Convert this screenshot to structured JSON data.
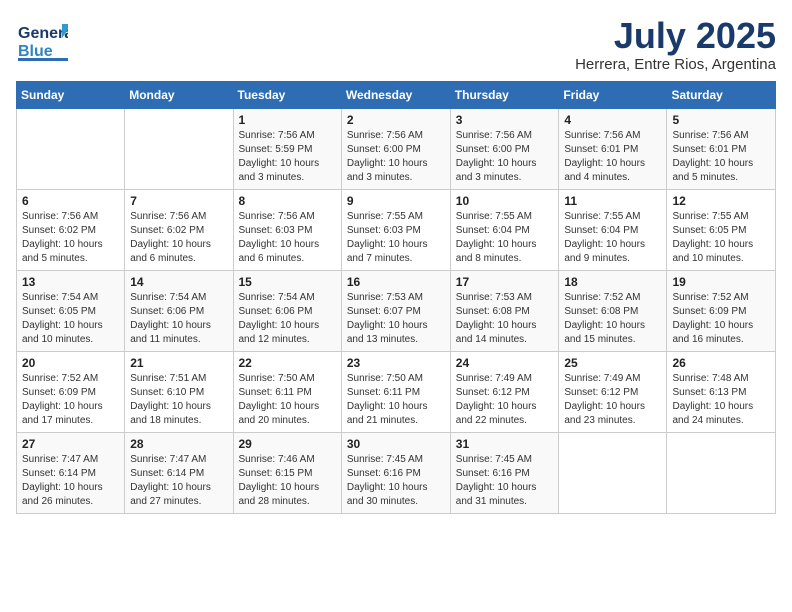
{
  "header": {
    "logo_general": "General",
    "logo_blue": "Blue",
    "month_title": "July 2025",
    "location": "Herrera, Entre Rios, Argentina"
  },
  "weekdays": [
    "Sunday",
    "Monday",
    "Tuesday",
    "Wednesday",
    "Thursday",
    "Friday",
    "Saturday"
  ],
  "weeks": [
    [
      {
        "day": "",
        "sunrise": "",
        "sunset": "",
        "daylight": ""
      },
      {
        "day": "",
        "sunrise": "",
        "sunset": "",
        "daylight": ""
      },
      {
        "day": "1",
        "sunrise": "Sunrise: 7:56 AM",
        "sunset": "Sunset: 5:59 PM",
        "daylight": "Daylight: 10 hours and 3 minutes."
      },
      {
        "day": "2",
        "sunrise": "Sunrise: 7:56 AM",
        "sunset": "Sunset: 6:00 PM",
        "daylight": "Daylight: 10 hours and 3 minutes."
      },
      {
        "day": "3",
        "sunrise": "Sunrise: 7:56 AM",
        "sunset": "Sunset: 6:00 PM",
        "daylight": "Daylight: 10 hours and 3 minutes."
      },
      {
        "day": "4",
        "sunrise": "Sunrise: 7:56 AM",
        "sunset": "Sunset: 6:01 PM",
        "daylight": "Daylight: 10 hours and 4 minutes."
      },
      {
        "day": "5",
        "sunrise": "Sunrise: 7:56 AM",
        "sunset": "Sunset: 6:01 PM",
        "daylight": "Daylight: 10 hours and 5 minutes."
      }
    ],
    [
      {
        "day": "6",
        "sunrise": "Sunrise: 7:56 AM",
        "sunset": "Sunset: 6:02 PM",
        "daylight": "Daylight: 10 hours and 5 minutes."
      },
      {
        "day": "7",
        "sunrise": "Sunrise: 7:56 AM",
        "sunset": "Sunset: 6:02 PM",
        "daylight": "Daylight: 10 hours and 6 minutes."
      },
      {
        "day": "8",
        "sunrise": "Sunrise: 7:56 AM",
        "sunset": "Sunset: 6:03 PM",
        "daylight": "Daylight: 10 hours and 6 minutes."
      },
      {
        "day": "9",
        "sunrise": "Sunrise: 7:55 AM",
        "sunset": "Sunset: 6:03 PM",
        "daylight": "Daylight: 10 hours and 7 minutes."
      },
      {
        "day": "10",
        "sunrise": "Sunrise: 7:55 AM",
        "sunset": "Sunset: 6:04 PM",
        "daylight": "Daylight: 10 hours and 8 minutes."
      },
      {
        "day": "11",
        "sunrise": "Sunrise: 7:55 AM",
        "sunset": "Sunset: 6:04 PM",
        "daylight": "Daylight: 10 hours and 9 minutes."
      },
      {
        "day": "12",
        "sunrise": "Sunrise: 7:55 AM",
        "sunset": "Sunset: 6:05 PM",
        "daylight": "Daylight: 10 hours and 10 minutes."
      }
    ],
    [
      {
        "day": "13",
        "sunrise": "Sunrise: 7:54 AM",
        "sunset": "Sunset: 6:05 PM",
        "daylight": "Daylight: 10 hours and 10 minutes."
      },
      {
        "day": "14",
        "sunrise": "Sunrise: 7:54 AM",
        "sunset": "Sunset: 6:06 PM",
        "daylight": "Daylight: 10 hours and 11 minutes."
      },
      {
        "day": "15",
        "sunrise": "Sunrise: 7:54 AM",
        "sunset": "Sunset: 6:06 PM",
        "daylight": "Daylight: 10 hours and 12 minutes."
      },
      {
        "day": "16",
        "sunrise": "Sunrise: 7:53 AM",
        "sunset": "Sunset: 6:07 PM",
        "daylight": "Daylight: 10 hours and 13 minutes."
      },
      {
        "day": "17",
        "sunrise": "Sunrise: 7:53 AM",
        "sunset": "Sunset: 6:08 PM",
        "daylight": "Daylight: 10 hours and 14 minutes."
      },
      {
        "day": "18",
        "sunrise": "Sunrise: 7:52 AM",
        "sunset": "Sunset: 6:08 PM",
        "daylight": "Daylight: 10 hours and 15 minutes."
      },
      {
        "day": "19",
        "sunrise": "Sunrise: 7:52 AM",
        "sunset": "Sunset: 6:09 PM",
        "daylight": "Daylight: 10 hours and 16 minutes."
      }
    ],
    [
      {
        "day": "20",
        "sunrise": "Sunrise: 7:52 AM",
        "sunset": "Sunset: 6:09 PM",
        "daylight": "Daylight: 10 hours and 17 minutes."
      },
      {
        "day": "21",
        "sunrise": "Sunrise: 7:51 AM",
        "sunset": "Sunset: 6:10 PM",
        "daylight": "Daylight: 10 hours and 18 minutes."
      },
      {
        "day": "22",
        "sunrise": "Sunrise: 7:50 AM",
        "sunset": "Sunset: 6:11 PM",
        "daylight": "Daylight: 10 hours and 20 minutes."
      },
      {
        "day": "23",
        "sunrise": "Sunrise: 7:50 AM",
        "sunset": "Sunset: 6:11 PM",
        "daylight": "Daylight: 10 hours and 21 minutes."
      },
      {
        "day": "24",
        "sunrise": "Sunrise: 7:49 AM",
        "sunset": "Sunset: 6:12 PM",
        "daylight": "Daylight: 10 hours and 22 minutes."
      },
      {
        "day": "25",
        "sunrise": "Sunrise: 7:49 AM",
        "sunset": "Sunset: 6:12 PM",
        "daylight": "Daylight: 10 hours and 23 minutes."
      },
      {
        "day": "26",
        "sunrise": "Sunrise: 7:48 AM",
        "sunset": "Sunset: 6:13 PM",
        "daylight": "Daylight: 10 hours and 24 minutes."
      }
    ],
    [
      {
        "day": "27",
        "sunrise": "Sunrise: 7:47 AM",
        "sunset": "Sunset: 6:14 PM",
        "daylight": "Daylight: 10 hours and 26 minutes."
      },
      {
        "day": "28",
        "sunrise": "Sunrise: 7:47 AM",
        "sunset": "Sunset: 6:14 PM",
        "daylight": "Daylight: 10 hours and 27 minutes."
      },
      {
        "day": "29",
        "sunrise": "Sunrise: 7:46 AM",
        "sunset": "Sunset: 6:15 PM",
        "daylight": "Daylight: 10 hours and 28 minutes."
      },
      {
        "day": "30",
        "sunrise": "Sunrise: 7:45 AM",
        "sunset": "Sunset: 6:16 PM",
        "daylight": "Daylight: 10 hours and 30 minutes."
      },
      {
        "day": "31",
        "sunrise": "Sunrise: 7:45 AM",
        "sunset": "Sunset: 6:16 PM",
        "daylight": "Daylight: 10 hours and 31 minutes."
      },
      {
        "day": "",
        "sunrise": "",
        "sunset": "",
        "daylight": ""
      },
      {
        "day": "",
        "sunrise": "",
        "sunset": "",
        "daylight": ""
      }
    ]
  ]
}
